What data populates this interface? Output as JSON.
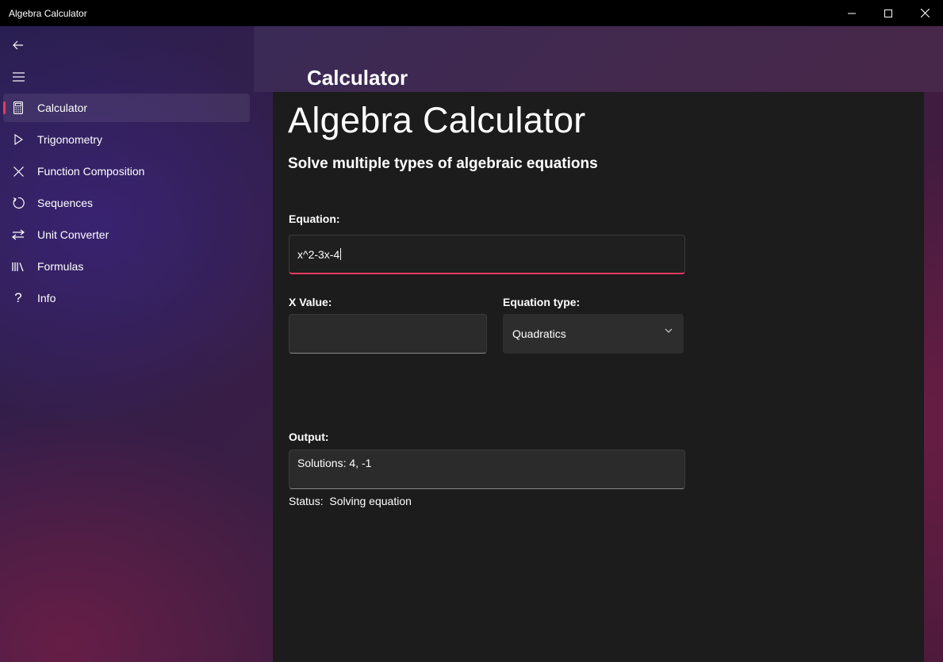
{
  "window": {
    "title": "Algebra Calculator",
    "controls": [
      "minimize-icon",
      "maximize-icon",
      "close-icon"
    ]
  },
  "sidebar": {
    "items": [
      {
        "label": "Calculator",
        "icon": "calculator-icon",
        "selected": true
      },
      {
        "label": "Trigonometry",
        "icon": "triangle-play-icon"
      },
      {
        "label": "Function Composition",
        "icon": "x-mark-icon"
      },
      {
        "label": "Sequences",
        "icon": "refresh-icon"
      },
      {
        "label": "Unit Converter",
        "icon": "swap-arrows-icon"
      },
      {
        "label": "Formulas",
        "icon": "library-icon"
      },
      {
        "label": "Info",
        "icon": "question-icon"
      }
    ]
  },
  "header": {
    "title": "Calculator"
  },
  "main": {
    "title": "Algebra Calculator",
    "subtitle": "Solve multiple types of algebraic equations",
    "equation": {
      "label": "Equation:",
      "value": "x^2-3x-4"
    },
    "x_value": {
      "label": "X Value:",
      "value": ""
    },
    "equation_type": {
      "label": "Equation type:",
      "selected": "Quadratics"
    },
    "output": {
      "label": "Output:",
      "value": "Solutions: 4, -1"
    },
    "status": {
      "label": "Status:",
      "value": "Solving equation"
    }
  },
  "colors": {
    "accent": "#e83a5f",
    "panel": "#1c1c1c"
  }
}
